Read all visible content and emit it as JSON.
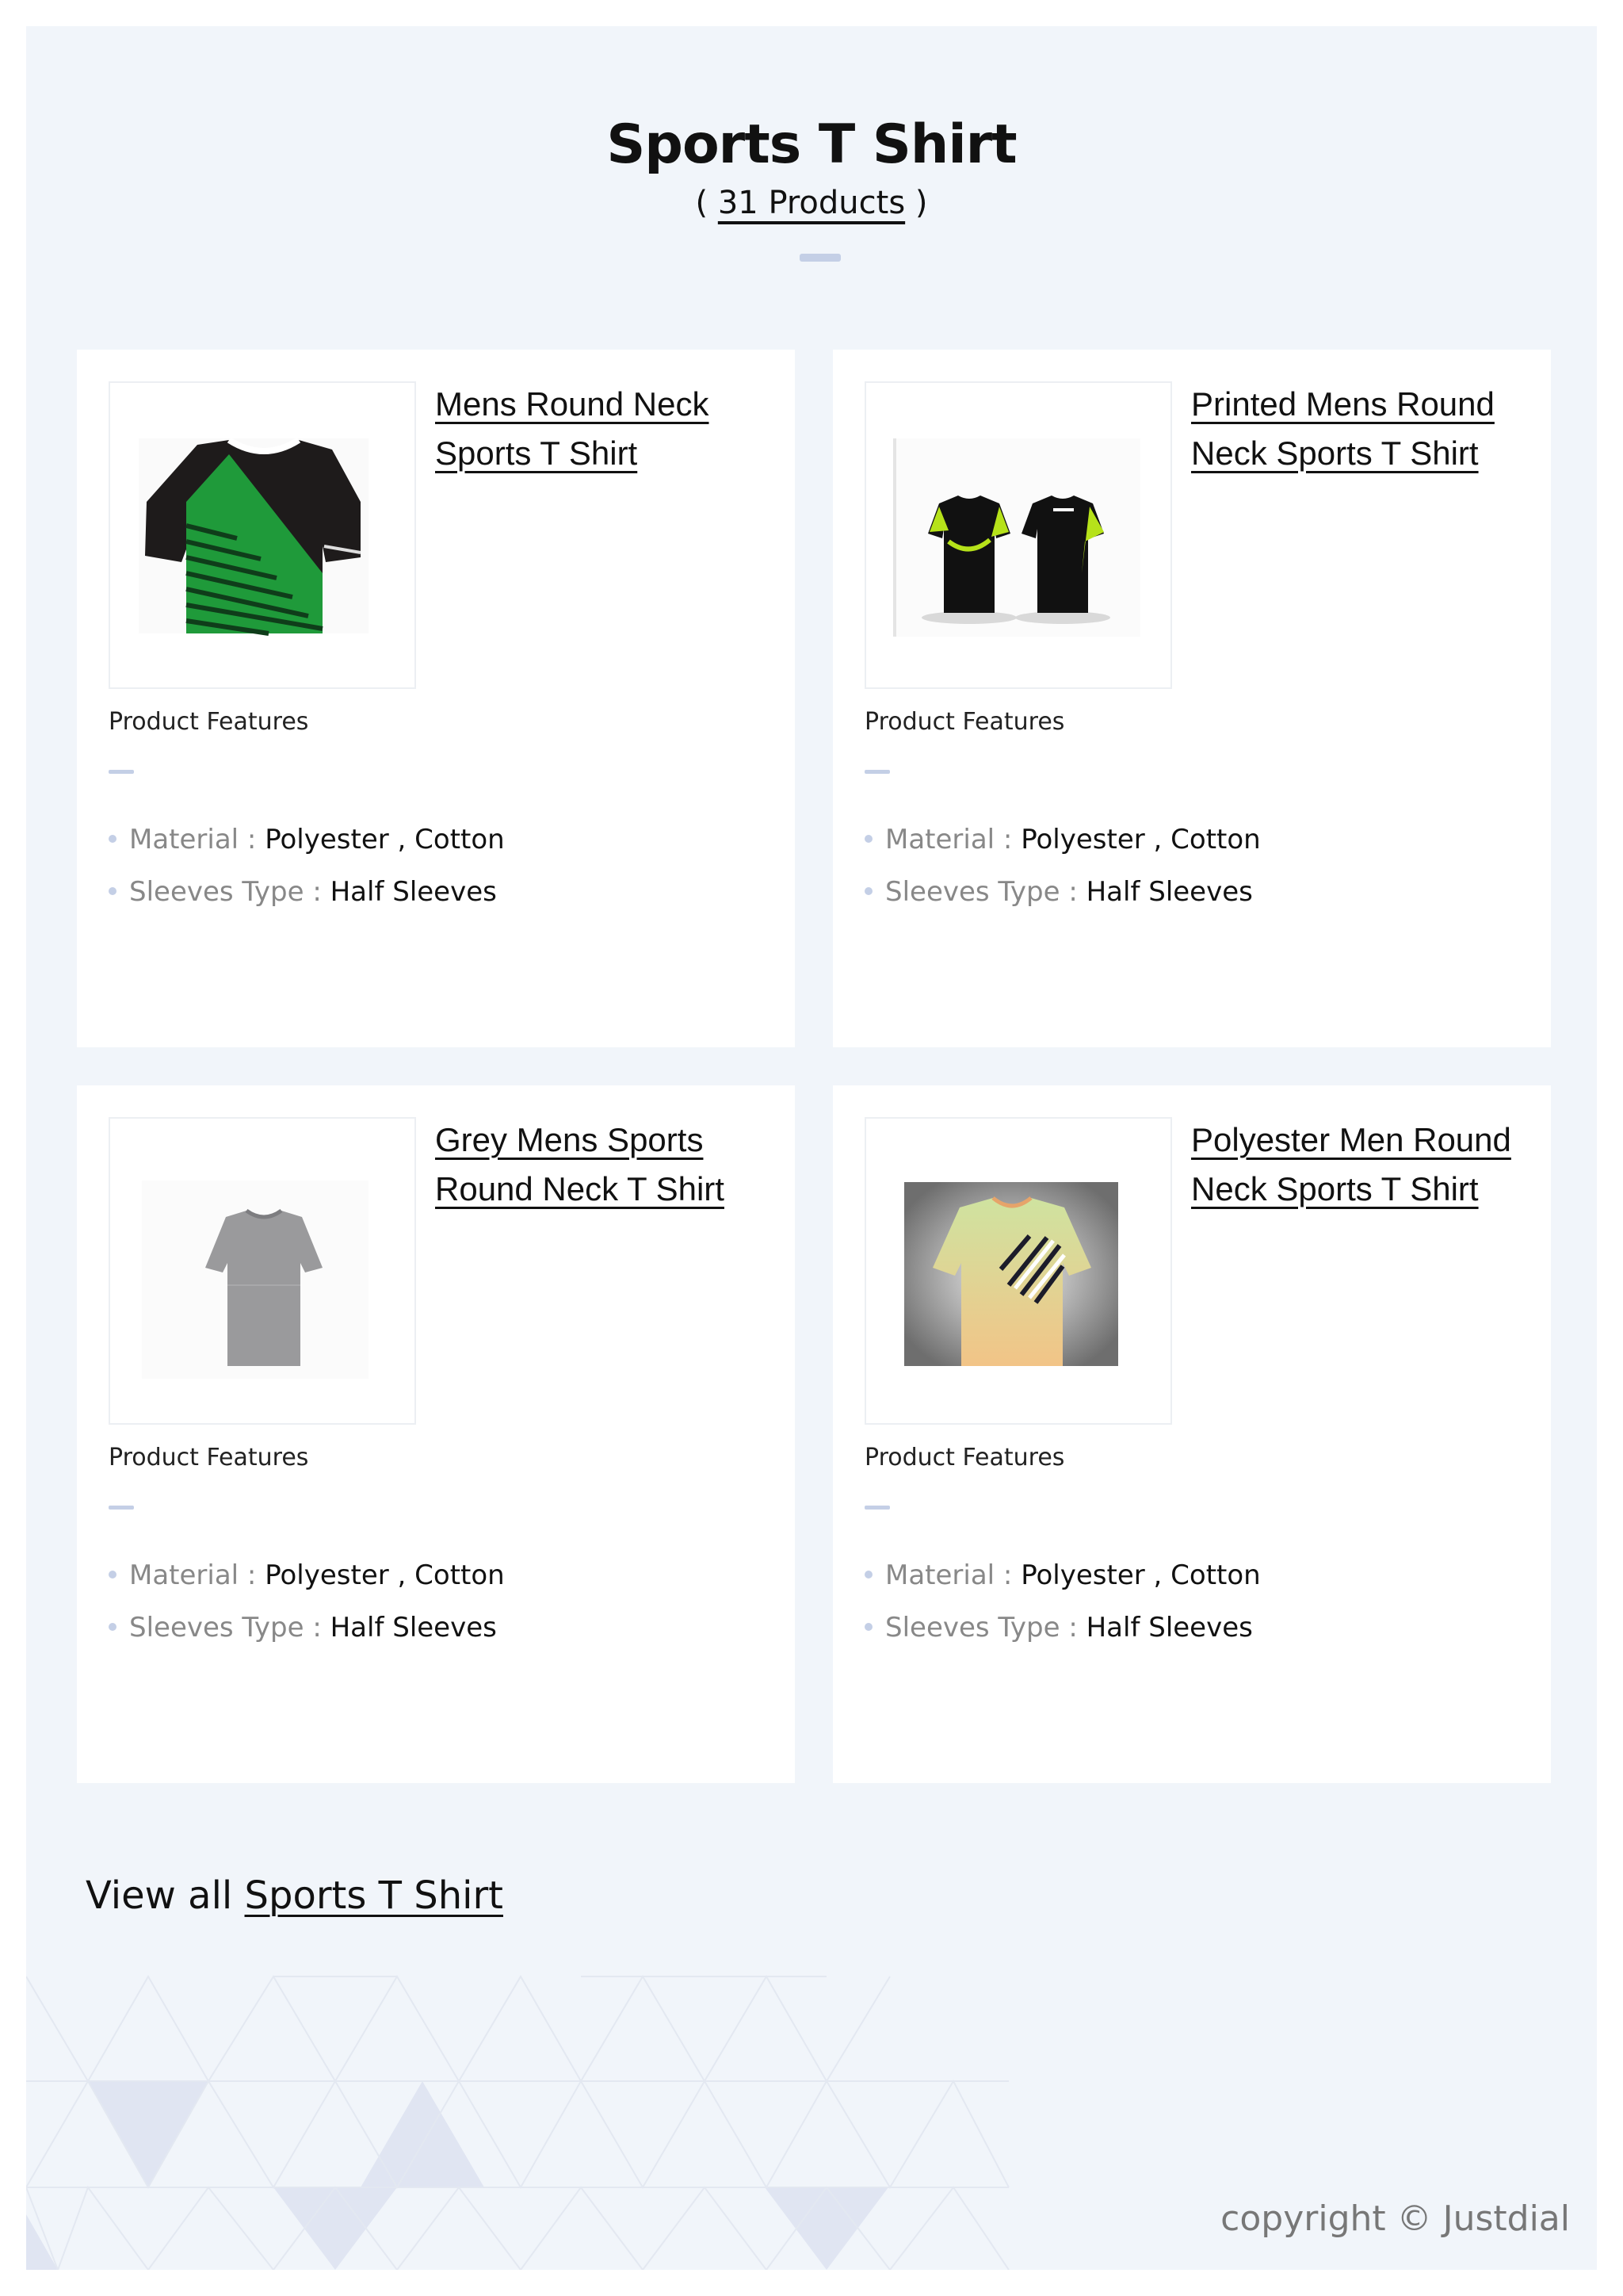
{
  "header": {
    "title": "Sports T Shirt",
    "subtitle_open": "( ",
    "subtitle_link": "31 Products",
    "subtitle_close": " )"
  },
  "products": [
    {
      "name": "Mens Round Neck Sports T Shirt",
      "features_label": "Product Features",
      "features": [
        {
          "key": "Material",
          "sep": " : ",
          "value": "Polyester , Cotton"
        },
        {
          "key": "Sleeves Type",
          "sep": " : ",
          "value": "Half Sleeves"
        }
      ]
    },
    {
      "name": "Printed Mens Round Neck Sports T Shirt",
      "features_label": "Product Features",
      "features": [
        {
          "key": "Material",
          "sep": " : ",
          "value": "Polyester , Cotton"
        },
        {
          "key": "Sleeves Type",
          "sep": " : ",
          "value": "Half Sleeves"
        }
      ]
    },
    {
      "name": "Grey Mens Sports Round Neck T Shirt",
      "features_label": "Product Features",
      "features": [
        {
          "key": "Material",
          "sep": " : ",
          "value": "Polyester , Cotton"
        },
        {
          "key": "Sleeves Type",
          "sep": " : ",
          "value": "Half Sleeves"
        }
      ]
    },
    {
      "name": "Polyester Men Round Neck Sports T Shirt",
      "features_label": "Product Features",
      "features": [
        {
          "key": "Material",
          "sep": " : ",
          "value": "Polyester , Cotton"
        },
        {
          "key": "Sleeves Type",
          "sep": " : ",
          "value": "Half Sleeves"
        }
      ]
    }
  ],
  "footer": {
    "view_all_prefix": "View all ",
    "view_all_link": "Sports T Shirt",
    "copyright": "copyright © Justdial"
  },
  "colors": {
    "page_bg": "#f1f5fa",
    "accent_rule": "#c4cfe6",
    "card_bg": "#ffffff"
  }
}
